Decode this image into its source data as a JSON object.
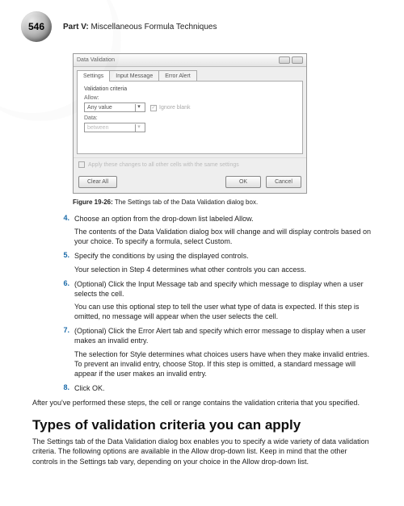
{
  "page_number": "546",
  "part_label": "Part V:",
  "part_title": "Miscellaneous Formula Techniques",
  "dialog": {
    "title": "Data Validation",
    "tabs": [
      "Settings",
      "Input Message",
      "Error Alert"
    ],
    "section_label": "Validation criteria",
    "allow_label": "Allow:",
    "allow_value": "Any value",
    "ignore_blank": "Ignore blank",
    "data_label": "Data:",
    "data_value": "between",
    "apply_text": "Apply these changes to all other cells with the same settings",
    "clear_all": "Clear All",
    "ok": "OK",
    "cancel": "Cancel"
  },
  "caption_bold": "Figure 19-26:",
  "caption_text": " The Settings tab of the Data Validation dialog box.",
  "steps": [
    {
      "n": "4.",
      "text": "Choose an option from the drop-down list labeled Allow.",
      "followup": "The contents of the Data Validation dialog box will change and will display controls based on your choice. To specify a formula, select Custom."
    },
    {
      "n": "5.",
      "text": "Specify the conditions by using the displayed controls.",
      "followup": "Your selection in Step 4 determines what other controls you can access."
    },
    {
      "n": "6.",
      "text": "(Optional) Click the Input Message tab and specify which message to display when a user selects the cell.",
      "followup": "You can use this optional step to tell the user what type of data is expected. If this step is omitted, no message will appear when the user selects the cell."
    },
    {
      "n": "7.",
      "text": "(Optional) Click the Error Alert tab and specify which error message to display when a user makes an invalid entry.",
      "followup": "The selection for Style determines what choices users have when they make invalid entries. To prevent an invalid entry, choose Stop. If this step is omitted, a standard message will appear if the user makes an invalid entry."
    },
    {
      "n": "8.",
      "text": "Click OK.",
      "followup": ""
    }
  ],
  "after_text": "After you've performed these steps, the cell or range contains the validation criteria that you specified.",
  "section_heading": "Types of validation criteria you can apply",
  "body_text": "The Settings tab of the Data Validation dialog box enables you to specify a wide variety of data validation criteria. The following options are available in the Allow drop-down list. Keep in mind that the other controls in the Settings tab vary, depending on your choice in the Allow drop-down list."
}
